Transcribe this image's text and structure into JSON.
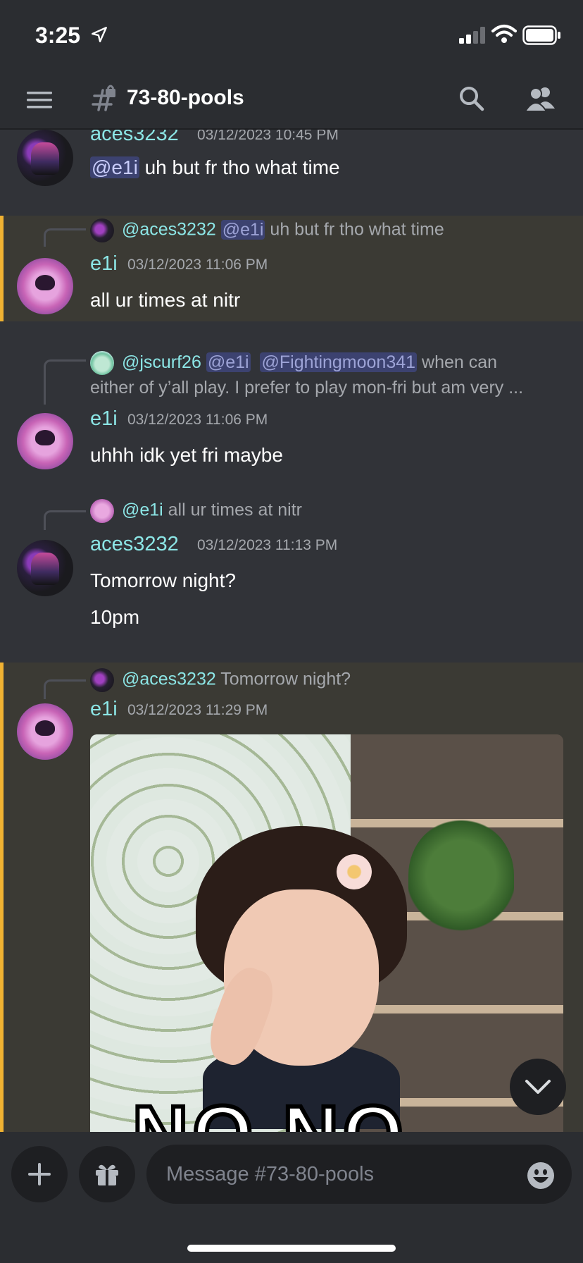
{
  "status_bar": {
    "time": "3:25"
  },
  "header": {
    "channel_name": "73-80-pools"
  },
  "messages": [
    {
      "author": "aces3232",
      "timestamp": "03/12/2023 10:45 PM",
      "mention": "@e1i",
      "text": "uh but fr tho what time"
    },
    {
      "reply_author": "@aces3232",
      "reply_mention": "@e1i",
      "reply_text": "uh but fr tho what time",
      "author": "e1i",
      "timestamp": "03/12/2023 11:06 PM",
      "text": "all ur times at nitr"
    },
    {
      "reply_author": "@jscurf26",
      "reply_mention1": "@e1i",
      "reply_mention2": "@Fightingmoon341",
      "reply_text1": "when can",
      "reply_text2": "either of y’all play. I prefer to play mon-fri but am very ...",
      "author": "e1i",
      "timestamp": "03/12/2023 11:06 PM",
      "text": "uhhh idk yet fri maybe"
    },
    {
      "reply_author": "@e1i",
      "reply_text": "all ur times at nitr",
      "author": "aces3232",
      "timestamp": "03/12/2023 11:13 PM",
      "text": "Tomorrow night?",
      "text2": "10pm"
    },
    {
      "reply_author": "@aces3232",
      "reply_text": "Tomorrow night?",
      "author": "e1i",
      "timestamp": "03/12/2023 11:29 PM",
      "gif_caption": "NO NO"
    }
  ],
  "composer": {
    "placeholder": "Message #73-80-pools"
  },
  "icons": {
    "status": [
      "location-arrow-icon",
      "signal-icon",
      "wifi-icon",
      "battery-icon"
    ],
    "header": [
      "menu-icon",
      "channel-lock-icon",
      "search-icon",
      "members-icon"
    ],
    "composer": [
      "plus-icon",
      "gift-icon",
      "emoji-icon"
    ],
    "floating": [
      "chevron-down-icon"
    ]
  },
  "colors": {
    "background": "#313338",
    "header": "#2b2d31",
    "author": "#8ce6e6",
    "mention_bg": "#3c4270",
    "highlight_bg": "#3b3a34",
    "highlight_bar": "#f0b232"
  }
}
